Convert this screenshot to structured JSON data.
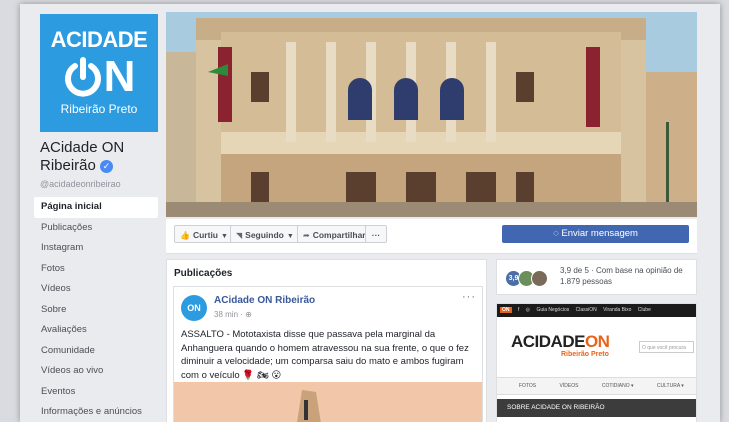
{
  "brand": {
    "logo_top": "ACIDADE",
    "logo_on_n": "N",
    "logo_city": "Ribeirão Preto",
    "accent": "#2d9be0"
  },
  "page": {
    "name": "ACidade ON Ribeirão",
    "handle": "@acidadeonribeirao",
    "verified_icon": "check"
  },
  "nav": [
    "Página inicial",
    "Publicações",
    "Instagram",
    "Fotos",
    "Vídeos",
    "Sobre",
    "Avaliações",
    "Comunidade",
    "Vídeos ao vivo",
    "Eventos",
    "Informações e anúncios"
  ],
  "actions": {
    "like": "Curtiu",
    "following": "Seguindo",
    "share": "Compartilhar",
    "more": "···",
    "message": "Enviar mensagem"
  },
  "posts": {
    "title": "Publicações",
    "post": {
      "avatar": "ON",
      "author": "ACidade ON Ribeirão",
      "time": "38 min · ⊕",
      "more": "···",
      "text": "ASSALTO - Mototaxista disse que passava pela marginal da Anhanguera quando o homem atravessou na sua frente, o que o fez diminuir a velocidade; um comparsa saiu do mato e ambos fugiram com o veículo 🌹 🏍 😮"
    }
  },
  "rating": {
    "score": "3,9",
    "text": "3,9 de 5 · Com base na opinião de 1.879 pessoas"
  },
  "preview": {
    "bar_items": [
      "ON",
      "f",
      "◎",
      "Guia Negócios",
      "ClassiON",
      "Viranda Bixo",
      "Clube"
    ],
    "logo_a": "ACIDADE",
    "logo_b": "ON",
    "logo_sub": "Ribeirão Preto",
    "search_placeholder": "O que você procura",
    "nav_items": [
      "FOTOS",
      "VÍDEOS",
      "COTIDIANO ▾",
      "CULTURA ▾"
    ],
    "band": "SOBRE ACIDADE ON RIBEIRÃO"
  }
}
